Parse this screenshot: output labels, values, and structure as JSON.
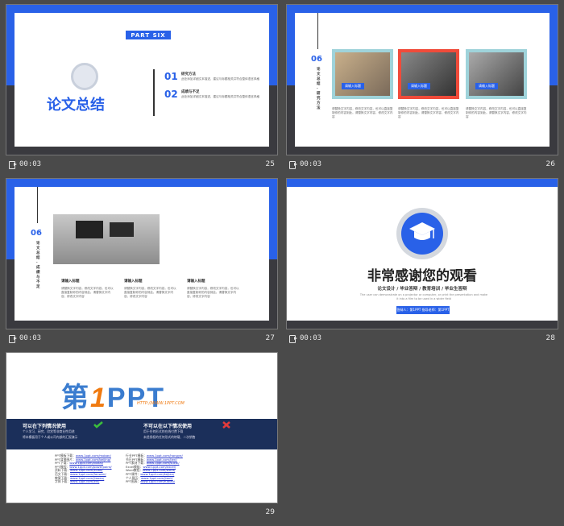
{
  "slides": [
    {
      "number": "25",
      "duration": "00:03",
      "part_label": "PART SIX",
      "title": "论文总结",
      "items": [
        {
          "num": "01",
          "heading": "研究方法",
          "text": "此处添加详细文本描述，建议与标题相关并符合整体语言风格"
        },
        {
          "num": "02",
          "heading": "成绩与不足",
          "text": "此处添加详细文本描述，建议与标题相关并符合整体语言风格"
        }
      ]
    },
    {
      "number": "26",
      "duration": "00:03",
      "section_num": "06",
      "vertical_text": "论文总结·研究方法",
      "cards": [
        {
          "label": "请输入标题",
          "text": "请替换文字内容，修改文字内容，也可以直接复制你的内容到此。请替换文字内容，修改文字内容"
        },
        {
          "label": "请输入标题",
          "text": "请替换文字内容，修改文字内容，也可以直接复制你的内容到此。请替换文字内容，修改文字内容"
        },
        {
          "label": "请输入标题",
          "text": "请替换文字内容，修改文字内容，也可以直接复制你的内容到此。请替换文字内容，修改文字内容"
        }
      ]
    },
    {
      "number": "27",
      "duration": "00:03",
      "section_num": "06",
      "vertical_text": "论文总结·成绩与不足",
      "cards": [
        {
          "label": "请输入标题",
          "text": "请替换文字内容，修改文字内容，也可以直接复制你的内容到此。请替换文字内容，修改文字内容"
        },
        {
          "label": "请输入标题",
          "text": "请替换文字内容，修改文字内容，也可以直接复制你的内容到此。请替换文字内容，修改文字内容"
        },
        {
          "label": "请输入标题",
          "text": "请替换文字内容，修改文字内容，也可以直接复制你的内容到此。请替换文字内容，修改文字内容"
        }
      ]
    },
    {
      "number": "28",
      "duration": "00:03",
      "title": "非常感谢您的观看",
      "subtitle": "论文设计 / 毕业答辩 / 教育培训 / 毕业生答辩",
      "english": "The user can demonstrate on a projector or computer, or print the presentation and make it into a film to be used in a wider field",
      "button": "答辩人：第1PPT  指导老师：第1PPT"
    },
    {
      "number": "29",
      "logo_main": "第",
      "logo_one": "1",
      "logo_ppt": "PPT",
      "logo_url": "HTTP://WWW.1PPT.COM",
      "can_use_title": "可以在下列情况使用",
      "can_use_items": [
        "个人学习、研究、欣赏等非商业性用途",
        "将本模板用于个人或公司内部的汇报演示"
      ],
      "cannot_use_title": "不可以在以下情况使用",
      "cannot_use_items": [
        "用于任何形式的在线付费下载",
        "未经授权的任何形式的转载、二次销售"
      ],
      "links_left": [
        [
          "PPT模板下载：",
          "www.1ppt.com/moban/"
        ],
        [
          "PPT背景图片：",
          "www.1ppt.com/beijing/"
        ],
        [
          "PPT下载：",
          "www.1ppt.com/xiazai/"
        ],
        [
          "PPT教程：",
          "www.1ppt.com/powerpoint/"
        ],
        [
          "资料下载：",
          "www.1ppt.com/ziliao/"
        ],
        [
          "范文下载：",
          "www.1ppt.com/fanwen/"
        ],
        [
          "教案下载：",
          "www.1ppt.com/jiaoan/"
        ],
        [
          "字体下载：",
          "www.1ppt.com/ziti/"
        ]
      ],
      "links_right": [
        [
          "行业PPT模板：",
          "www.1ppt.com/hangye/"
        ],
        [
          "节日PPT模板：",
          "www.1ppt.com/jieri/"
        ],
        [
          "PPT素材下载：",
          "www.1ppt.com/sucai/"
        ],
        [
          "Excel模板：",
          "www.1ppt.com/excel/"
        ],
        [
          "Word教程：",
          "www.1ppt.com/word/"
        ],
        [
          "PPT课件：",
          "www.1ppt.com/kejian/"
        ],
        [
          "个人简历：",
          "www.1ppt.com/jianli/"
        ],
        [
          "PPT图表：",
          "www.1ppt.com/tubiao/"
        ]
      ]
    }
  ]
}
